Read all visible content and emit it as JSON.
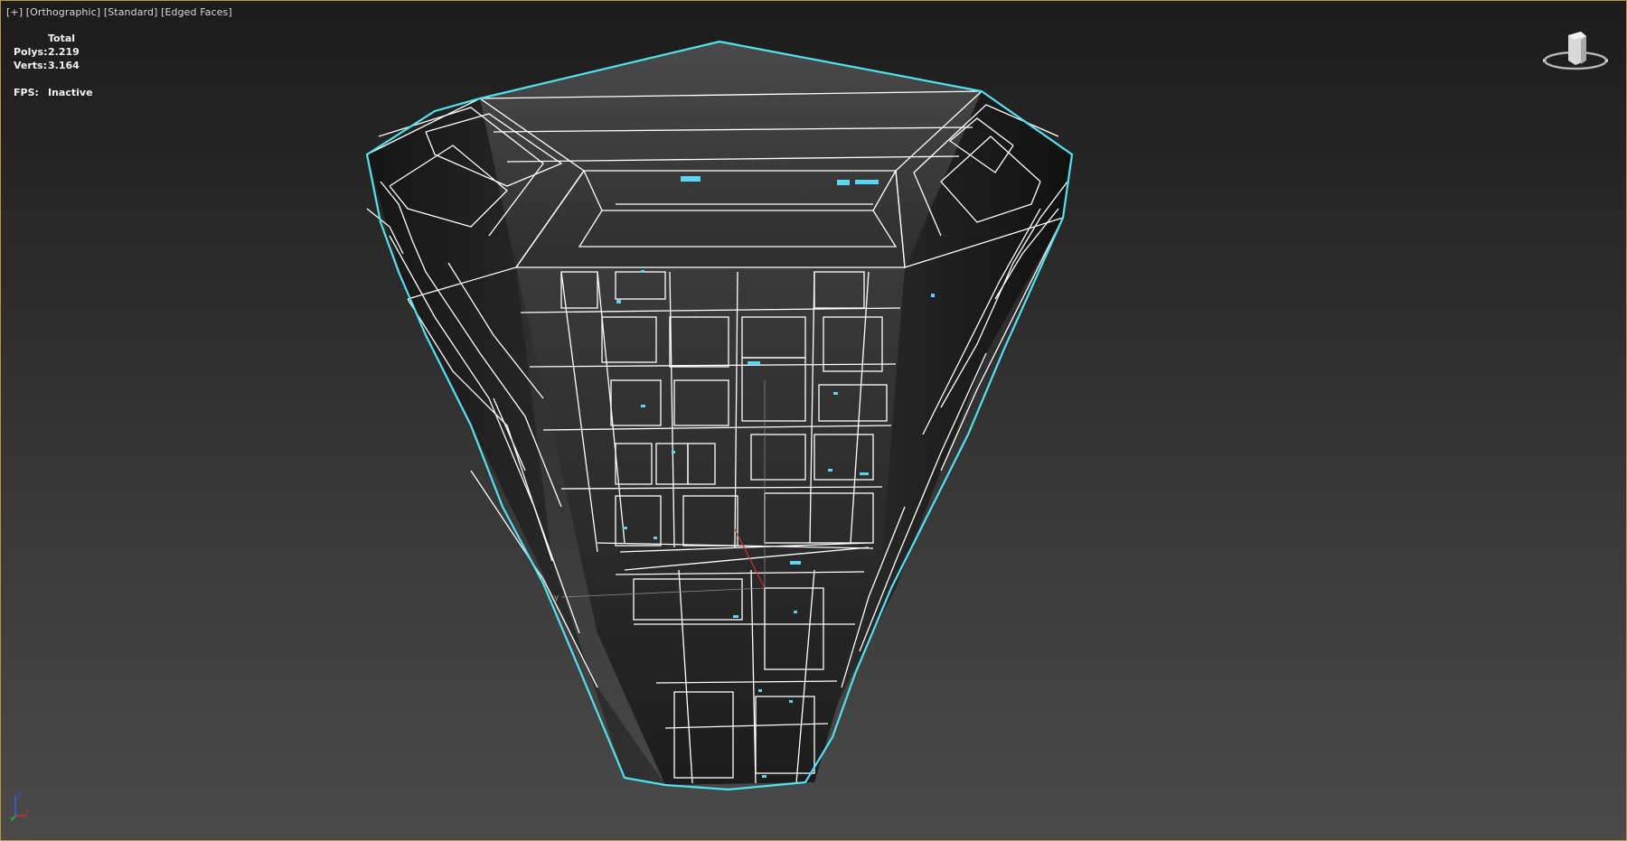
{
  "viewport": {
    "label": {
      "plus": "[+]",
      "view": "[Orthographic]",
      "shading": "[Standard]",
      "mode": "[Edged Faces]"
    },
    "stats": {
      "header": "Total",
      "polys_label": "Polys:",
      "polys_value": "2.219",
      "verts_label": "Verts:",
      "verts_value": "3.164",
      "fps_label": "FPS:",
      "fps_value": "Inactive"
    },
    "axis": {
      "x": "x",
      "y": "y",
      "z": "z"
    },
    "pivot_label": "y"
  },
  "colors": {
    "selection_outline": "#4fe3ef",
    "wireframe": "#ffffff",
    "viewport_border": "#b49a3c",
    "axis_x": "#d03030",
    "axis_y": "#30c030",
    "axis_z": "#3060ff",
    "detail_accent": "#5ad6f0"
  }
}
